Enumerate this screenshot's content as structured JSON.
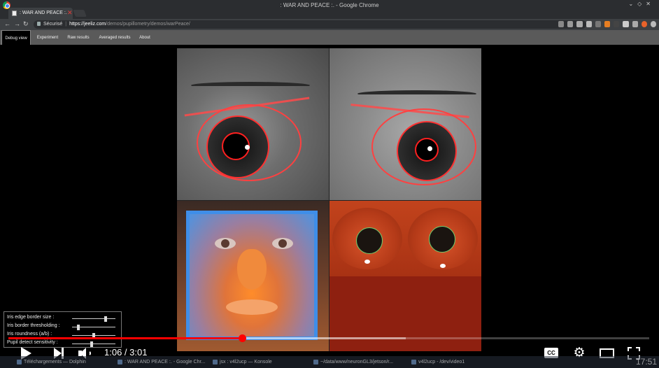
{
  "browser": {
    "window_title": ": WAR AND PEACE :. - Google Chrome",
    "tab_title": ": WAR AND PEACE :.",
    "secure_label": "Sécurisé",
    "url_host": "https://jeeliz.com",
    "url_path": "/demos/pupillometry/demos/warPeace/"
  },
  "page_tabs": [
    "Debug view",
    "Experiment",
    "Raw results",
    "Averaged results",
    "About"
  ],
  "sliders": [
    {
      "label": "Iris edge border size :",
      "value": 0.8
    },
    {
      "label": "Iris border thresholding :",
      "value": 0.12
    },
    {
      "label": "Iris roundness (a/b) :",
      "value": 0.5
    },
    {
      "label": "Pupil detect sensitivity :",
      "value": 0.45
    }
  ],
  "player": {
    "time_current": "1:06",
    "time_total": "3:01",
    "time_display": "1:06 / 3:01",
    "progress": 0.365,
    "buffered": 0.62,
    "cc_label": "CC"
  },
  "taskbar": {
    "items": [
      "Téléchargements — Dolphin",
      ": WAR AND PEACE :. - Google Chr...",
      "jsx : v4l2ucp — Konsole",
      "~/data/www/neuronGL3/jetson/r...",
      "v4l2ucp - /dev/video1"
    ],
    "clock": "17:51"
  }
}
